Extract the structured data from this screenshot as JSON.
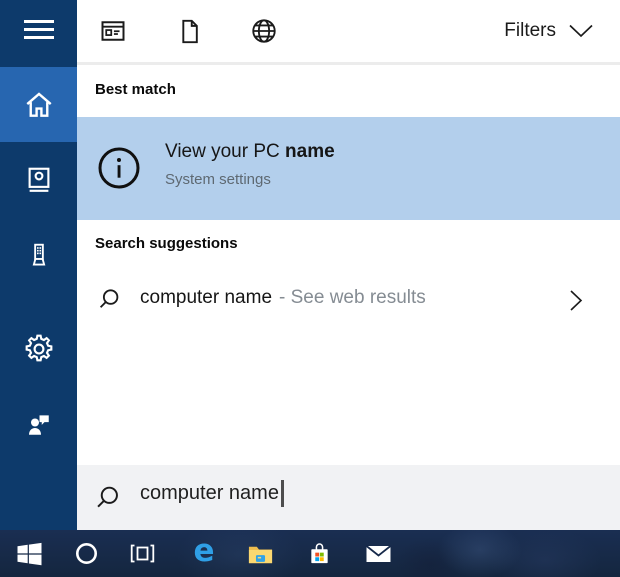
{
  "colors": {
    "sidebar_bg": "#0d3a6b",
    "sidebar_active_bg": "#2766b0",
    "result_highlight": "#b3cfec",
    "searchbox_bg": "#f1f2f4",
    "taskbar_bg": "#16294a",
    "edge_blue": "#2f9fe6",
    "folder_yellow": "#fbd871",
    "store_red": "#f25022",
    "store_green": "#7fba00",
    "store_blue": "#00a4ef",
    "store_yellow": "#ffb900"
  },
  "sidebar": {
    "items": [
      {
        "icon": "menu-icon"
      },
      {
        "icon": "home-icon",
        "active": true
      },
      {
        "icon": "notebook-icon"
      },
      {
        "icon": "devices-icon"
      },
      {
        "icon": "settings-gear-icon"
      },
      {
        "icon": "feedback-icon"
      }
    ]
  },
  "topbar": {
    "icons": [
      "apps-icon",
      "document-icon",
      "web-globe-icon"
    ],
    "filters_label": "Filters",
    "filters_icon": "chevron-down-icon"
  },
  "content": {
    "best_match_heading": "Best match",
    "result": {
      "icon": "info-icon",
      "title_prefix": "View your PC ",
      "title_bold": "name",
      "subtitle": "System settings"
    },
    "suggestions_heading": "Search suggestions",
    "suggestion": {
      "icon": "search-icon",
      "query": "computer name",
      "hint": "- See web results",
      "chevron": "chevron-right-icon"
    }
  },
  "searchbox": {
    "icon": "search-icon",
    "value": "computer name"
  },
  "taskbar": {
    "buttons": [
      "start",
      "cortana",
      "task-view",
      "edge",
      "file-explorer",
      "store",
      "mail"
    ]
  }
}
